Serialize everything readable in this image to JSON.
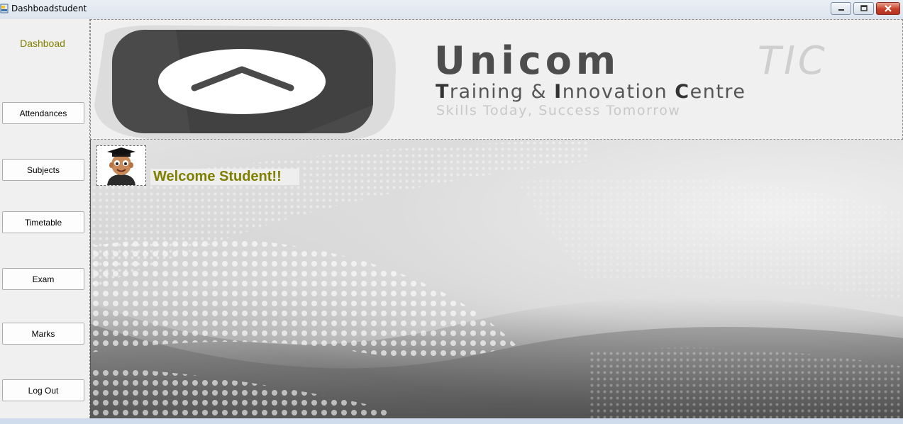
{
  "window": {
    "title": "Dashboadstudent",
    "controls": [
      "minimize",
      "maximize",
      "close"
    ]
  },
  "sidebar": {
    "title": "Dashboad",
    "buttons": [
      {
        "label": "Attendances"
      },
      {
        "label": "Subjects"
      },
      {
        "label": "Timetable"
      },
      {
        "label": "Exam"
      },
      {
        "label": "Marks"
      },
      {
        "label": "Log Out"
      }
    ]
  },
  "header": {
    "brand_name": "Unicom",
    "brand_suffix": "TIC",
    "full_name_parts": [
      "T",
      "raining & ",
      "I",
      "nnovation ",
      "C",
      "entre"
    ],
    "tagline": "Skills Today, Success Tomorrow",
    "colors": {
      "brand_dark": "#4d4d4d",
      "brand_light": "#cfcfcf",
      "tagline": "#c8c8c8"
    }
  },
  "main": {
    "welcome_text": "Welcome Student!!",
    "welcome_color": "#808000",
    "avatar_icon": "student-graduate-icon"
  }
}
